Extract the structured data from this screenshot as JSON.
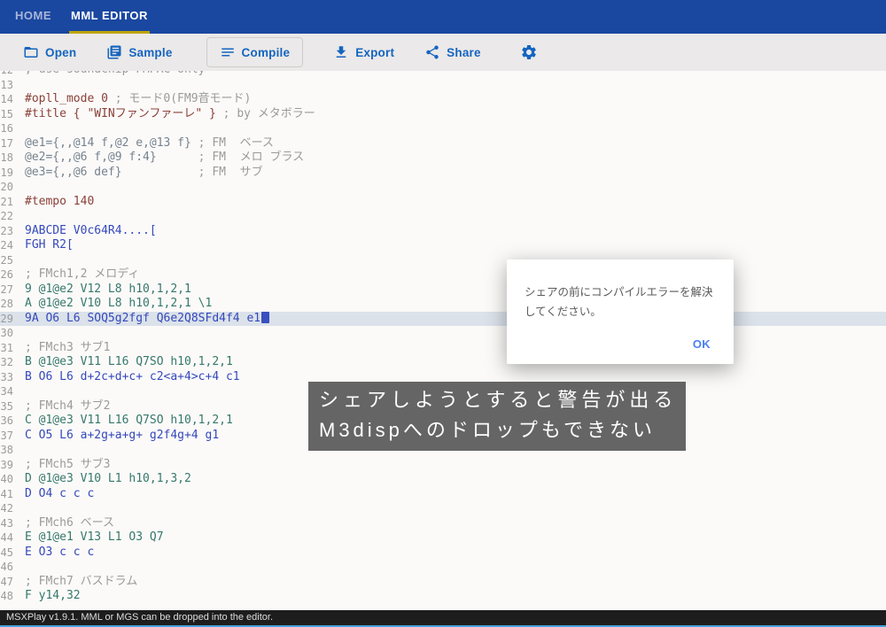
{
  "header": {
    "tabs": [
      {
        "id": "home",
        "label": "HOME"
      },
      {
        "id": "mml-editor",
        "label": "MML EDITOR",
        "active": true
      }
    ]
  },
  "toolbar": {
    "buttons": [
      {
        "id": "open",
        "label": "Open",
        "icon": "folder-open-icon"
      },
      {
        "id": "sample",
        "label": "Sample",
        "icon": "library-icon"
      },
      {
        "id": "compile",
        "label": "Compile",
        "icon": "list-icon"
      },
      {
        "id": "export",
        "label": "Export",
        "icon": "download-icon"
      },
      {
        "id": "share",
        "label": "Share",
        "icon": "share-icon"
      }
    ],
    "settings_icon": "gear-icon",
    "accent_color": "#1565c0"
  },
  "editor": {
    "active_line": 29,
    "lines": [
      {
        "no": 12,
        "segments": [
          {
            "text": "; use soundchip FMPAC only",
            "type": "comment"
          }
        ]
      },
      {
        "no": 13,
        "segments": []
      },
      {
        "no": 14,
        "segments": [
          {
            "text": "#opll_mode 0 ",
            "type": "directive"
          },
          {
            "text": "; モード0(FM9音モード)",
            "type": "comment"
          }
        ]
      },
      {
        "no": 15,
        "segments": [
          {
            "text": "#title { \"WINファンファーレ\" } ",
            "type": "directive"
          },
          {
            "text": "; by メタボラー",
            "type": "comment"
          }
        ]
      },
      {
        "no": 16,
        "segments": []
      },
      {
        "no": 17,
        "segments": [
          {
            "text": "@e1={,,@14 f,@2 e,@13 f} ",
            "type": "env"
          },
          {
            "text": "; FM  ベース",
            "type": "comment"
          }
        ]
      },
      {
        "no": 18,
        "segments": [
          {
            "text": "@e2={,,@6 f,@9 f:4}      ",
            "type": "env"
          },
          {
            "text": "; FM  メロ ブラス",
            "type": "comment"
          }
        ]
      },
      {
        "no": 19,
        "segments": [
          {
            "text": "@e3={,,@6 def}           ",
            "type": "env"
          },
          {
            "text": "; FM  サブ",
            "type": "comment"
          }
        ]
      },
      {
        "no": 20,
        "segments": []
      },
      {
        "no": 21,
        "segments": [
          {
            "text": "#tempo 140",
            "type": "directive"
          }
        ]
      },
      {
        "no": 22,
        "segments": []
      },
      {
        "no": 23,
        "segments": [
          {
            "text": "9ABCDE V0c64R4....[",
            "type": "note"
          }
        ]
      },
      {
        "no": 24,
        "segments": [
          {
            "text": "FGH R2[",
            "type": "note"
          }
        ]
      },
      {
        "no": 25,
        "segments": []
      },
      {
        "no": 26,
        "segments": [
          {
            "text": "; FMch1,2 メロディ",
            "type": "comment"
          }
        ]
      },
      {
        "no": 27,
        "segments": [
          {
            "text": "9 @1@e2 V12 L8 h10,1,2,1",
            "type": "defn"
          }
        ]
      },
      {
        "no": 28,
        "segments": [
          {
            "text": "A @1@e2 V10 L8 h10,1,2,1 \\1",
            "type": "defn"
          }
        ]
      },
      {
        "no": 29,
        "segments": [
          {
            "text": "9A O6 L6 SOQ5g2fgf Q6e2Q8SFd4f4 e1",
            "type": "note"
          }
        ],
        "active": true,
        "cursor": true
      },
      {
        "no": 30,
        "segments": []
      },
      {
        "no": 31,
        "segments": [
          {
            "text": "; FMch3 サブ1",
            "type": "comment"
          }
        ]
      },
      {
        "no": 32,
        "segments": [
          {
            "text": "B @1@e3 V11 L16 Q7SO h10,1,2,1",
            "type": "defn"
          }
        ]
      },
      {
        "no": 33,
        "segments": [
          {
            "text": "B O6 L6 d+2c+d+c+ c2<a+4>c+4 c1",
            "type": "note"
          }
        ]
      },
      {
        "no": 34,
        "segments": []
      },
      {
        "no": 35,
        "segments": [
          {
            "text": "; FMch4 サブ2",
            "type": "comment"
          }
        ]
      },
      {
        "no": 36,
        "segments": [
          {
            "text": "C @1@e3 V11 L16 Q7SO h10,1,2,1",
            "type": "defn"
          }
        ]
      },
      {
        "no": 37,
        "segments": [
          {
            "text": "C O5 L6 a+2g+a+g+ g2f4g+4 g1",
            "type": "note"
          }
        ]
      },
      {
        "no": 38,
        "segments": []
      },
      {
        "no": 39,
        "segments": [
          {
            "text": "; FMch5 サブ3",
            "type": "comment"
          }
        ]
      },
      {
        "no": 40,
        "segments": [
          {
            "text": "D @1@e3 V10 L1 h10,1,3,2",
            "type": "defn"
          }
        ]
      },
      {
        "no": 41,
        "segments": [
          {
            "text": "D O4 c c c",
            "type": "note"
          }
        ]
      },
      {
        "no": 42,
        "segments": []
      },
      {
        "no": 43,
        "segments": [
          {
            "text": "; FMch6 ベース",
            "type": "comment"
          }
        ]
      },
      {
        "no": 44,
        "segments": [
          {
            "text": "E @1@e1 V13 L1 O3 Q7",
            "type": "defn"
          }
        ]
      },
      {
        "no": 45,
        "segments": [
          {
            "text": "E O3 c c c",
            "type": "note"
          }
        ]
      },
      {
        "no": 46,
        "segments": []
      },
      {
        "no": 47,
        "segments": [
          {
            "text": "; FMch7 バスドラム",
            "type": "comment"
          }
        ]
      },
      {
        "no": 48,
        "segments": [
          {
            "text": "F y14,32",
            "type": "defn"
          }
        ]
      }
    ]
  },
  "dialog": {
    "message": "シェアの前にコンパイルエラーを解決してください。",
    "ok_label": "OK"
  },
  "annotation": {
    "line1": "シェアしようとすると警告が出る",
    "line2": "M3dispへのドロップもできない"
  },
  "statusbar": {
    "text": "MSXPlay v1.9.1. MML or MGS can be dropped into the editor."
  }
}
